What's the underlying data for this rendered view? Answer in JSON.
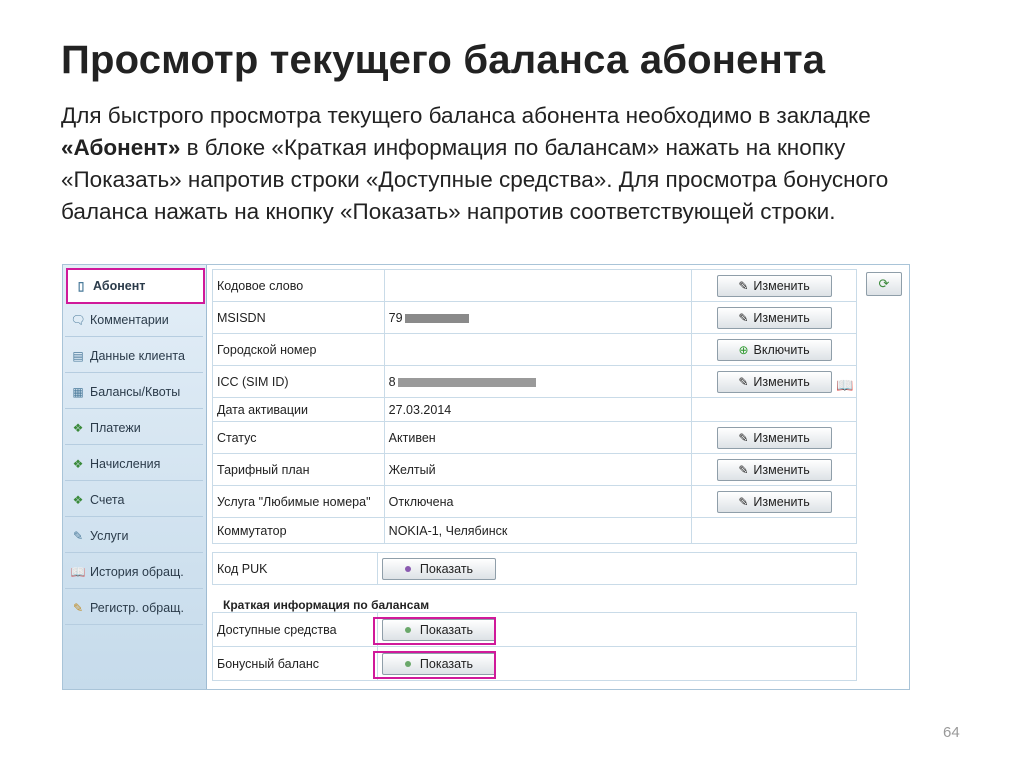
{
  "slide": {
    "title": "Просмотр текущего баланса абонента",
    "desc_1": "Для быстрого просмотра текущего баланса абонента необходимо в закладке ",
    "desc_bold": "«Абонент»",
    "desc_2": " в блоке «Краткая информация по балансам» нажать на кнопку «Показать» напротив строки «Доступные средства». Для просмотра бонусного баланса нажать на кнопку «Показать» напротив соответствующей строки.",
    "page_number": "64"
  },
  "sidebar": {
    "items": [
      {
        "label": "Абонент",
        "icon": "phone-icon",
        "active": true
      },
      {
        "label": "Комментарии",
        "icon": "comments-icon"
      },
      {
        "label": "Данные клиента",
        "icon": "id-card-icon"
      },
      {
        "label": "Балансы/Квоты",
        "icon": "balance-icon"
      },
      {
        "label": "Платежи",
        "icon": "money-icon"
      },
      {
        "label": "Начисления",
        "icon": "money-icon"
      },
      {
        "label": "Счета",
        "icon": "money-icon"
      },
      {
        "label": "Услуги",
        "icon": "services-icon"
      },
      {
        "label": "История обращ.",
        "icon": "book-icon"
      },
      {
        "label": "Регистр. обращ.",
        "icon": "register-icon"
      }
    ]
  },
  "subscriber": {
    "rows": [
      {
        "label": "Кодовое слово",
        "value": "",
        "action": "Изменить"
      },
      {
        "label": "MSISDN",
        "value": "79",
        "action": "Изменить"
      },
      {
        "label": "Городской номер",
        "value": "",
        "action": "Включить"
      },
      {
        "label": "ICC (SIM ID)",
        "value": "8",
        "action": "Изменить"
      },
      {
        "label": "Дата активации",
        "value": "27.03.2014",
        "action": ""
      },
      {
        "label": "Статус",
        "value": "Активен",
        "action": "Изменить"
      },
      {
        "label": "Тарифный план",
        "value": "Желтый",
        "action": "Изменить"
      },
      {
        "label": "Услуга \"Любимые номера\"",
        "value": "Отключена",
        "action": "Изменить"
      },
      {
        "label": "Коммутатор",
        "value": "NOKIA-1, Челябинск",
        "action": ""
      }
    ]
  },
  "puk": {
    "label": "Код PUK",
    "button": "Показать"
  },
  "balances": {
    "title": "Краткая информация по балансам",
    "available_label": "Доступные средства",
    "available_button": "Показать",
    "bonus_label": "Бонусный баланс",
    "bonus_button": "Показать"
  },
  "colors": {
    "highlight": "#d0199a",
    "sidebar": "#c6dbeb"
  }
}
